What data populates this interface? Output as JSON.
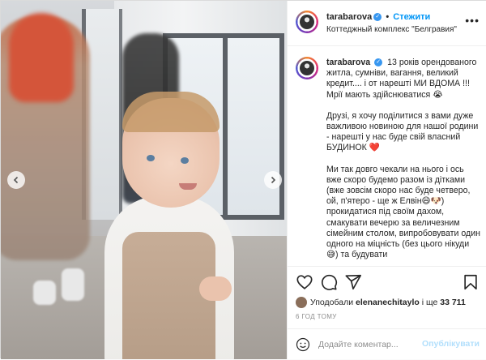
{
  "header": {
    "username": "tarabarova",
    "separator": "•",
    "follow_label": "Стежити",
    "location": "Коттеджный комплекс \"Белгравия\"",
    "more_icon": "more-horizontal-icon"
  },
  "caption": {
    "username": "tarabarova",
    "paragraphs": [
      "13 років орендованого житла, сумніви, вагання, великий кредит.... і от нарешті МИ ВДОМА !!! Мрії мають здійснюватися 😭",
      "Друзі, я хочу поділитися з вами дуже важливою новиною для нашої родини - нарешті у нас буде свій власний БУДИНОК ❤️",
      "Ми так довго чекали на нього і ось вже скоро будемо разом із дітками (вже зовсім скоро нас буде четверо, ой, п'ятеро - ще ж Елвін😄🐶) прокидатися під своїм дахом, смакувати вечерю за величезним сімейним столом, випробовувати один одного на міцність (без цього нікуди 😅) та будувати"
    ]
  },
  "actions": {
    "like_icon": "heart-icon",
    "comment_icon": "comment-icon",
    "share_icon": "share-icon",
    "save_icon": "bookmark-icon"
  },
  "likes": {
    "prefix": "Уподобали",
    "user": "elenanechitaylo",
    "middle": "і ще",
    "count": "33 711"
  },
  "time_ago": "6 год тому",
  "comment": {
    "placeholder": "Додайте коментар...",
    "publish_label": "Опублікувати"
  },
  "colors": {
    "accent": "#0095f6",
    "verified": "#3897f0",
    "publish_disabled": "#b2dffc"
  }
}
